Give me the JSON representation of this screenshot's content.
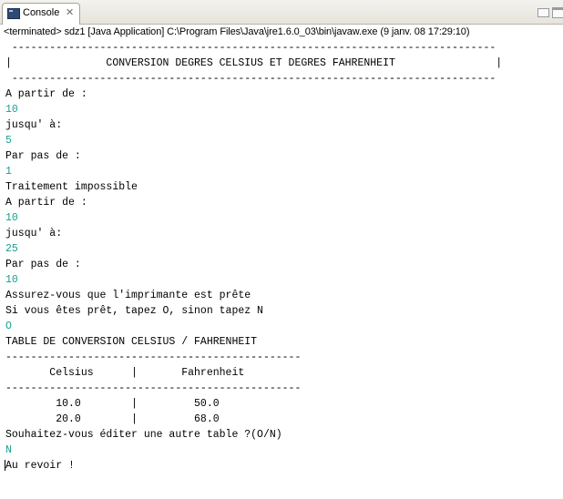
{
  "tab": {
    "label": "Console",
    "close_icon": "close-icon",
    "console_icon": "console-icon"
  },
  "status": "<terminated> sdz1 [Java Application] C:\\Program Files\\Java\\jre1.6.0_03\\bin\\javaw.exe (9 janv. 08 17:29:10)",
  "colors": {
    "output": "#000000",
    "input": "#18a090"
  },
  "console_lines": [
    {
      "text": " -----------------------------------------------------------------------------",
      "kind": "out"
    },
    {
      "text": "|               CONVERSION DEGRES CELSIUS ET DEGRES FAHRENHEIT                |",
      "kind": "out"
    },
    {
      "text": " -----------------------------------------------------------------------------",
      "kind": "out"
    },
    {
      "text": "A partir de :",
      "kind": "out"
    },
    {
      "text": "10",
      "kind": "in"
    },
    {
      "text": "jusqu' à:",
      "kind": "out"
    },
    {
      "text": "5",
      "kind": "in"
    },
    {
      "text": "Par pas de :",
      "kind": "out"
    },
    {
      "text": "1",
      "kind": "in"
    },
    {
      "text": "Traitement impossible",
      "kind": "out"
    },
    {
      "text": "A partir de :",
      "kind": "out"
    },
    {
      "text": "10",
      "kind": "in"
    },
    {
      "text": "jusqu' à:",
      "kind": "out"
    },
    {
      "text": "25",
      "kind": "in"
    },
    {
      "text": "Par pas de :",
      "kind": "out"
    },
    {
      "text": "10",
      "kind": "in"
    },
    {
      "text": "Assurez-vous que l'imprimante est prête",
      "kind": "out"
    },
    {
      "text": "Si vous êtes prêt, tapez O, sinon tapez N",
      "kind": "out"
    },
    {
      "text": "O",
      "kind": "in"
    },
    {
      "text": "TABLE DE CONVERSION CELSIUS / FAHRENHEIT",
      "kind": "out"
    },
    {
      "text": "-----------------------------------------------",
      "kind": "out"
    },
    {
      "text": "       Celsius      |       Fahrenheit",
      "kind": "out"
    },
    {
      "text": "-----------------------------------------------",
      "kind": "out"
    },
    {
      "text": "        10.0        |         50.0",
      "kind": "out"
    },
    {
      "text": "        20.0        |         68.0",
      "kind": "out"
    },
    {
      "text": "Souhaitez-vous éditer une autre table ?(O/N)",
      "kind": "out"
    },
    {
      "text": "N",
      "kind": "in"
    },
    {
      "text": "Au revoir !",
      "kind": "out"
    }
  ]
}
